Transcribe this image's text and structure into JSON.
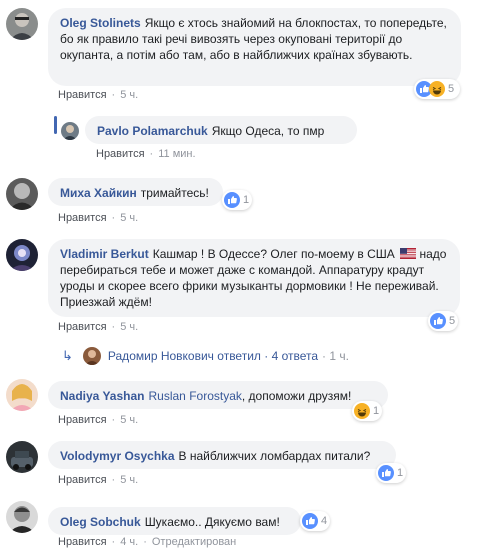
{
  "comments": [
    {
      "author": "Oleg Stolinets",
      "text": "Якщо є хтось знайомий на блокпостах, то попередьте, бо як правило такі речі вивозять через окуповані території до окупанта, а потім або там, або в найближчих країнах збувають.",
      "like": "Нравится",
      "time": "5 ч.",
      "reaction_count": "5",
      "reactions": [
        "like-reaction-icon",
        "haha-reaction-icon"
      ]
    },
    {
      "author": "Pavlo Polamarchuk",
      "text": "Якщо Одеса, то пмр",
      "like": "Нравится",
      "time": "11 мин."
    },
    {
      "author": "Миха Хайкин",
      "text": "тримайтесь!",
      "like": "Нравится",
      "time": "5 ч.",
      "reaction_count": "1",
      "reactions": [
        "like-reaction-icon"
      ]
    },
    {
      "author": "Vladimir Berkut",
      "text_before_flag": "Кашмар ! В Одессе? Олег по-моему в США",
      "text_after_flag": "надо перебираться тебе и может даже с командой. Аппаратуру крадут уроды и скорее всего фрики музыканты дормовики ! Не переживай. Приезжай ждём!",
      "like": "Нравится",
      "time": "5 ч.",
      "reaction_count": "5",
      "reactions": [
        "like-reaction-icon"
      ]
    },
    {
      "author": "Nadiya Yashan",
      "mention": "Ruslan Forostyak",
      "text": ", допоможи друзям!",
      "like": "Нравится",
      "time": "5 ч.",
      "reaction_count": "1",
      "reactions": [
        "haha-reaction-icon"
      ]
    },
    {
      "author": "Volodymyr Osychka",
      "text": "В найближчих ломбардах питали?",
      "like": "Нравится",
      "time": "5 ч.",
      "reaction_count": "1",
      "reactions": [
        "like-reaction-icon"
      ]
    },
    {
      "author": "Oleg Sobchuk",
      "text": "Шукаємо.. Дякуємо вам!",
      "like": "Нравится",
      "time": "4 ч.",
      "edited": "Отредактирован",
      "reaction_count": "4",
      "reactions": [
        "like-reaction-icon"
      ]
    }
  ],
  "replies_link": {
    "author": "Радомир Новкович",
    "text": "ответил · 4 ответа",
    "time": "1 ч."
  },
  "colors": {
    "link": "#385898",
    "bubble": "#f2f3f5",
    "meta": "#90949c",
    "like_blue": "#5890ff",
    "haha_yellow": "#f7b125"
  }
}
